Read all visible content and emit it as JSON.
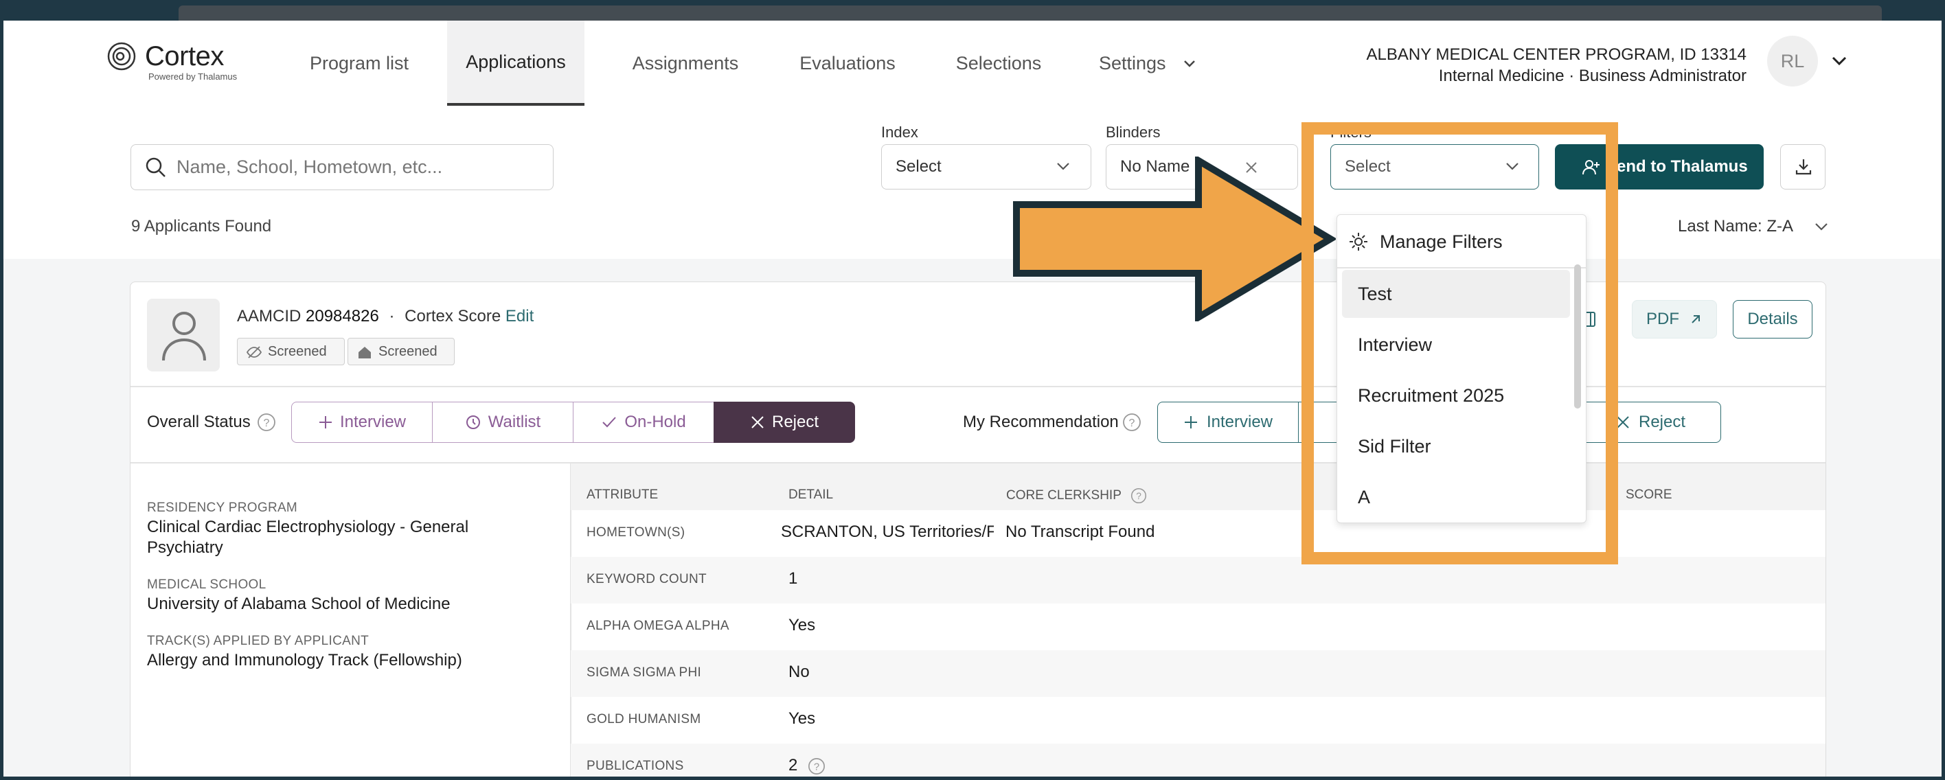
{
  "brand": {
    "name": "Cortex",
    "tagline": "Powered by Thalamus"
  },
  "nav": {
    "items": [
      {
        "label": "Program list"
      },
      {
        "label": "Applications"
      },
      {
        "label": "Assignments"
      },
      {
        "label": "Evaluations"
      },
      {
        "label": "Selections"
      },
      {
        "label": "Settings"
      }
    ],
    "active": "Applications"
  },
  "org": {
    "line1": "ALBANY MEDICAL CENTER PROGRAM, ID 13314",
    "line2": "Internal Medicine · Business Administrator",
    "initials": "RL"
  },
  "toolbar": {
    "search_placeholder": "Name, School, Hometown, etc...",
    "index_label": "Index",
    "index_value": "Select",
    "blinders_label": "Blinders",
    "blinders_value": "No Name",
    "filters_label": "Filters",
    "filters_value": "Select",
    "send_label": "end to Thalamus"
  },
  "results": {
    "count_text": "9 Applicants Found",
    "sort_text": "Last Name: Z-A"
  },
  "filters_dropdown": {
    "manage_label": "Manage Filters",
    "options": [
      "Test",
      "Interview",
      "Recruitment 2025",
      "Sid Filter",
      "A"
    ]
  },
  "applicant": {
    "aamcid_label": "AAMCID",
    "aamcid": "20984826",
    "dot": "·",
    "score_label": "Cortex Score",
    "edit_label": "Edit",
    "chips": [
      "Screened",
      "Screened"
    ],
    "pdf_label": "PDF",
    "details_label": "Details",
    "overall_status_label": "Overall Status",
    "status_options": [
      "Interview",
      "Waitlist",
      "On-Hold",
      "Reject"
    ],
    "selected_status": "Reject",
    "my_rec_label": "My Recommendation",
    "rec_options": [
      "Interview",
      "Reject"
    ],
    "residency_program_label": "RESIDENCY PROGRAM",
    "residency_program": "Clinical Cardiac Electrophysiology - General Psychiatry",
    "medical_school_label": "MEDICAL SCHOOL",
    "medical_school": "University of Alabama School of Medicine",
    "tracks_label": "TRACK(S) APPLIED BY APPLICANT",
    "tracks": "Allergy and Immunology Track (Fellowship)"
  },
  "table": {
    "headers": [
      "ATTRIBUTE",
      "DETAIL",
      "CORE CLERKSHIP",
      "SCORE"
    ],
    "rows": [
      {
        "attribute": "HOMETOWN(S)",
        "detail": "SCRANTON, US Territories/F",
        "extra": "No Transcript Found"
      },
      {
        "attribute": "KEYWORD COUNT",
        "detail": "1",
        "extra": ""
      },
      {
        "attribute": "ALPHA OMEGA ALPHA",
        "detail": "Yes",
        "extra": ""
      },
      {
        "attribute": "SIGMA SIGMA PHI",
        "detail": "No",
        "extra": ""
      },
      {
        "attribute": "GOLD HUMANISM",
        "detail": "Yes",
        "extra": ""
      },
      {
        "attribute": "PUBLICATIONS",
        "detail": "2",
        "extra": ""
      }
    ]
  },
  "colors": {
    "brand_teal": "#0f4f55",
    "accent_orange": "#f0a549",
    "reject_purple": "#4a3448",
    "frame_dark": "#1f3845"
  }
}
